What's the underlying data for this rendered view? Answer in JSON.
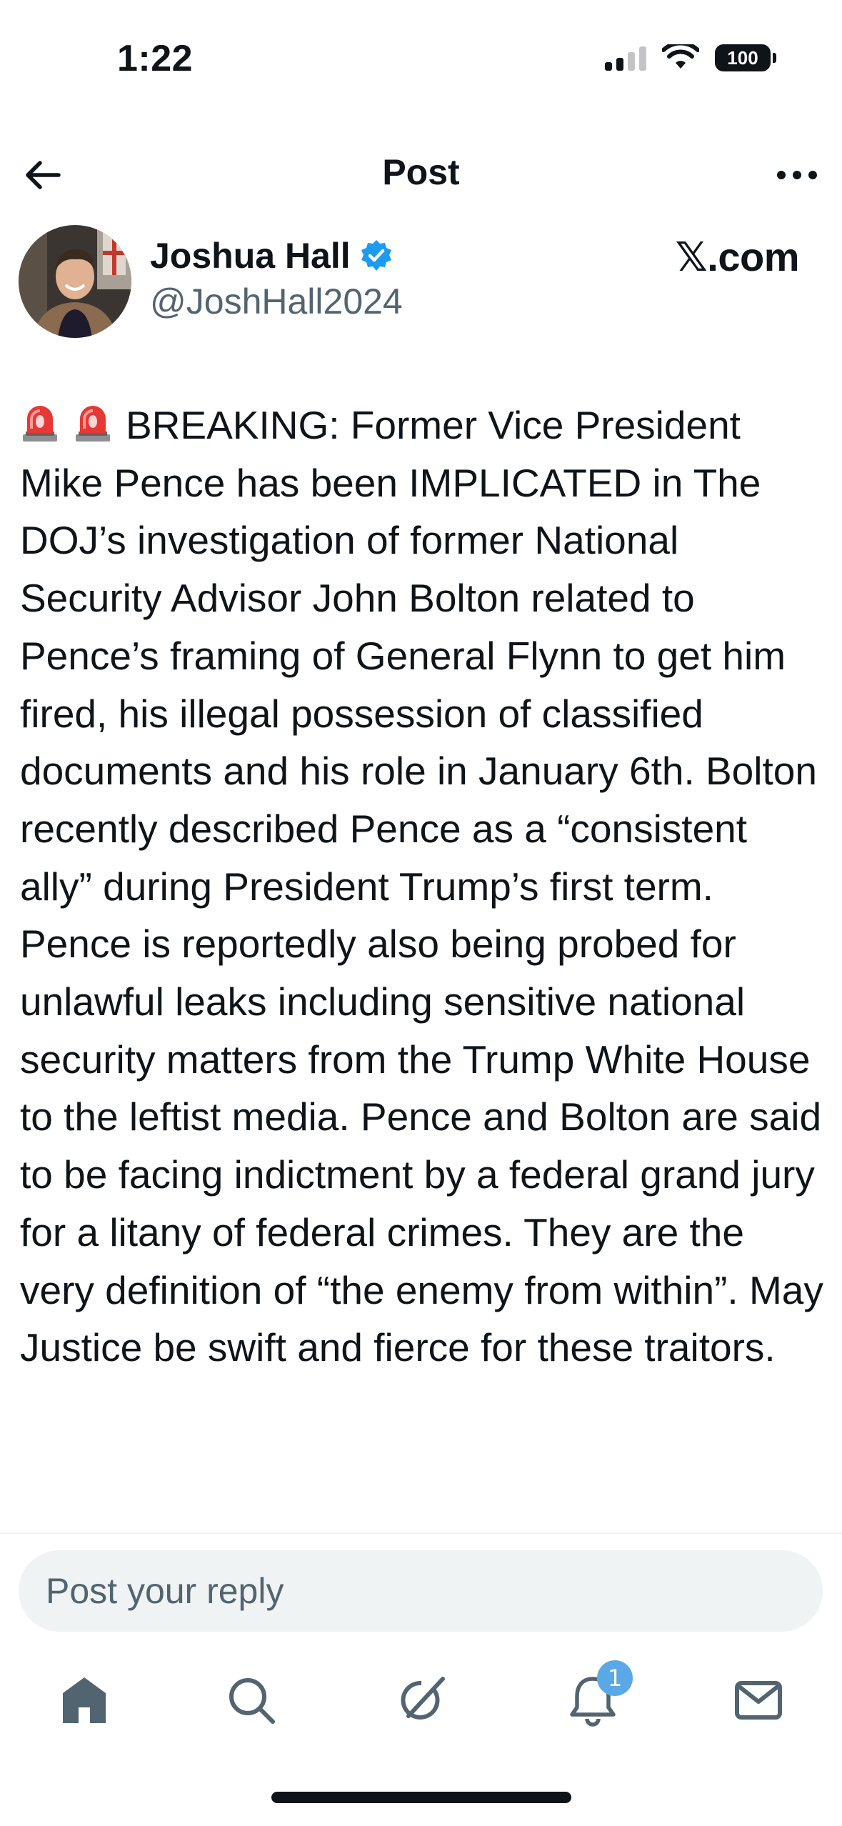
{
  "status_bar": {
    "time": "1:22",
    "battery": "100"
  },
  "header": {
    "title": "Post"
  },
  "author": {
    "name": "Joshua Hall",
    "handle": "@JoshHall2024",
    "source": "𝕏.com"
  },
  "post": {
    "text": "BREAKING: Former Vice President Mike Pence has been IMPLICATED in The DOJ’s investigation of former National Security Advisor John Bolton related to Pence’s framing of General Flynn to get him fired, his illegal possession of classified documents and his role in January 6th. Bolton recently described Pence as a “consistent ally” during President Trump’s first term. Pence is reportedly also being probed for unlawful leaks including sensitive national security matters from the Trump White House to the leftist media. Pence and Bolton are said to be facing indictment by a federal grand jury for a litany of federal crimes. They are the very definition of “the enemy from within”. May Justice be swift and fierce for these traitors.",
    "leading_icons": [
      "siren-icon",
      "siren-icon"
    ]
  },
  "reply": {
    "placeholder": "Post your reply"
  },
  "nav": {
    "items": [
      "home-icon",
      "search-icon",
      "grok-icon",
      "notifications-icon",
      "messages-icon"
    ],
    "notification_count": "1"
  },
  "colors": {
    "text": "#0f1419",
    "secondary": "#536471",
    "verified": "#1d9bf0",
    "badge": "#5aa9e6",
    "reply_bg": "#eff3f4"
  }
}
